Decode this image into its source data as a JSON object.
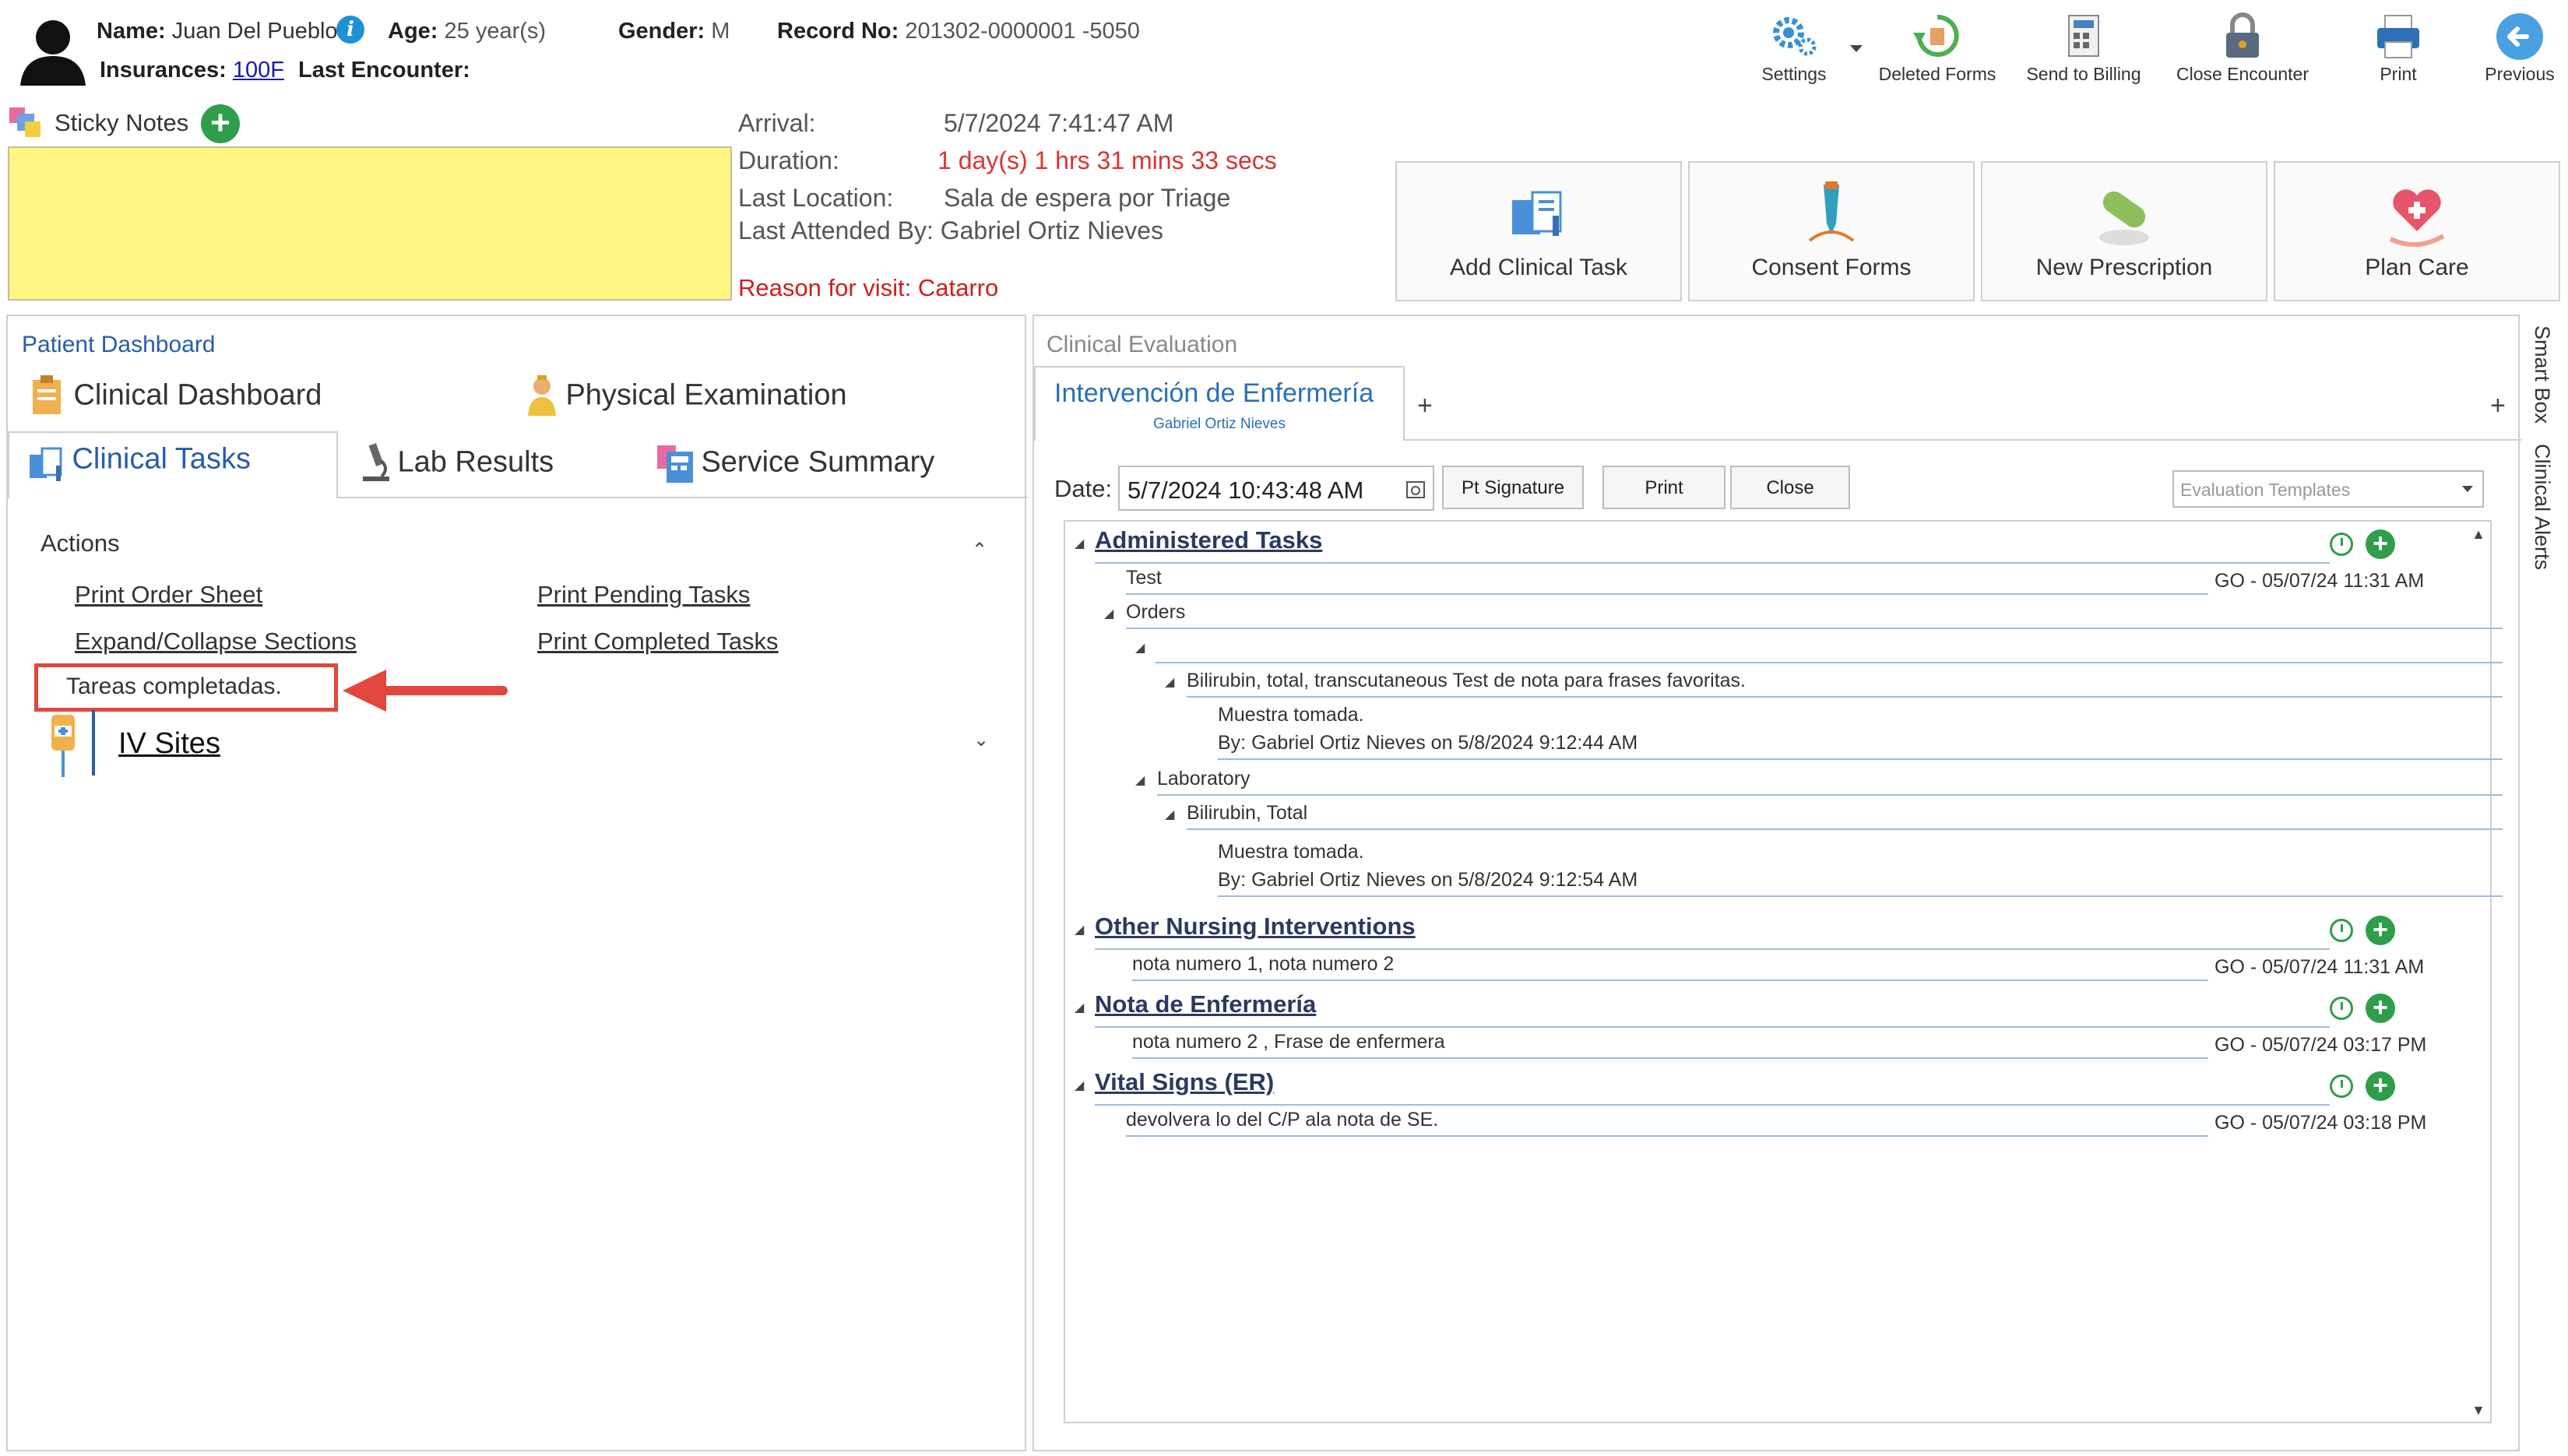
{
  "patient": {
    "name_label": "Name:",
    "name": "Juan Del Pueblo",
    "age_label": "Age:",
    "age": "25 year(s)",
    "gender_label": "Gender:",
    "gender": "M",
    "record_label": "Record No:",
    "record": "201302-0000001 -5050",
    "insurances_label": "Insurances:",
    "insurance": "100F",
    "last_encounter_label": "Last Encounter:"
  },
  "toolbar": {
    "settings": "Settings",
    "deleted_forms": "Deleted Forms",
    "send_to_billing": "Send to Billing",
    "close_encounter": "Close Encounter",
    "print": "Print",
    "previous": "Previous"
  },
  "sticky": {
    "label": "Sticky Notes"
  },
  "encounter": {
    "arrival_label": "Arrival:",
    "arrival": "5/7/2024 7:41:47 AM",
    "duration_label": "Duration:",
    "duration": "1 day(s) 1 hrs 31 mins 33 secs",
    "location_label": "Last Location:",
    "location": "Sala de espera por Triage",
    "attended_label": "Last Attended By:",
    "attended": "Gabriel Ortiz Nieves",
    "reason": "Reason for visit: Catarro"
  },
  "actions_bar": {
    "add_clinical_task": "Add Clinical Task",
    "consent_forms": "Consent Forms",
    "new_prescription": "New Prescription",
    "plan_care": "Plan Care"
  },
  "dashboard": {
    "title": "Patient Dashboard",
    "tabs": [
      "Clinical Dashboard",
      "Physical Examination",
      "Clinical Tasks",
      "Lab Results",
      "Service Summary"
    ],
    "actions_title": "Actions",
    "links": {
      "print_order_sheet": "Print Order Sheet",
      "print_pending_tasks": "Print Pending Tasks",
      "expand_collapse": "Expand/Collapse Sections",
      "print_completed_tasks": "Print Completed Tasks"
    },
    "callout": "Tareas completadas.",
    "iv_sites": "IV Sites"
  },
  "evaluation": {
    "title": "Clinical Evaluation",
    "tab_title": "Intervención de Enfermería",
    "tab_subtitle": "Gabriel Ortiz Nieves",
    "tab_plus": "+",
    "date_label": "Date:",
    "date_value": "5/7/2024 10:43:48 AM",
    "pt_signature": "Pt Signature",
    "print": "Print",
    "close": "Close",
    "templates_placeholder": "Evaluation Templates"
  },
  "sections": {
    "administered": "Administered Tasks",
    "test": "Test",
    "test_stamp": "GO - 05/07/24 11:31 AM",
    "orders": "Orders",
    "bilirubin_trans": "Bilirubin, total, transcutaneous Test de nota para frases favoritas.",
    "muestra1": "Muestra tomada.",
    "by1": "By: Gabriel Ortiz Nieves on 5/8/2024 9:12:44 AM",
    "laboratory": "Laboratory",
    "bilirubin_total": "Bilirubin, Total",
    "muestra2": "Muestra tomada.",
    "by2": "By: Gabriel Ortiz Nieves on 5/8/2024 9:12:54 AM",
    "other": "Other Nursing Interventions",
    "other_note": "nota numero 1, nota numero 2",
    "other_stamp": "GO - 05/07/24 11:31 AM",
    "nota": "Nota de Enfermería",
    "nota_note": "nota numero 2 , Frase de enfermera",
    "nota_stamp": "GO - 05/07/24 03:17 PM",
    "vital": "Vital Signs (ER)",
    "vital_note": "devolvera lo del C/P ala nota de SE.",
    "vital_stamp": "GO - 05/07/24 03:18 PM"
  },
  "side": {
    "smart_box": "Smart Box",
    "clinical_alerts": "Clinical Alerts"
  }
}
